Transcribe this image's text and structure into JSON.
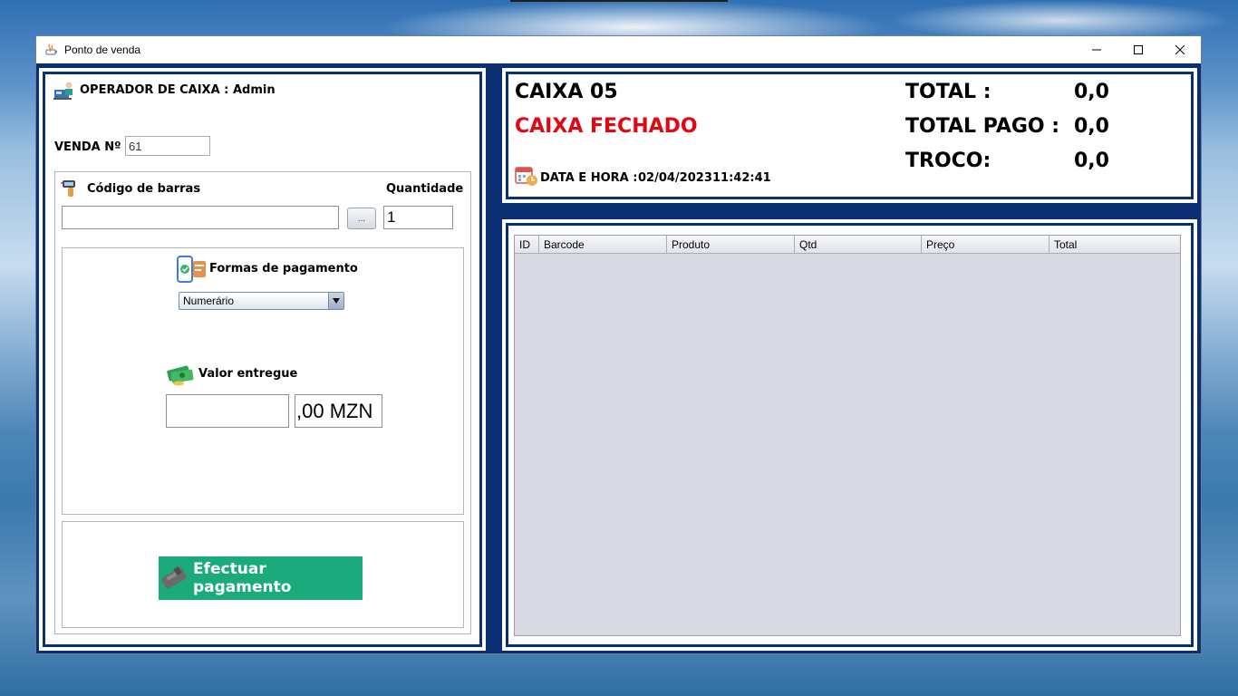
{
  "window": {
    "title": "Ponto de venda"
  },
  "left": {
    "operator_label": "OPERADOR DE CAIXA :",
    "operator_name": "Admin",
    "sale_label": "VENDA Nº",
    "sale_number": "61",
    "barcode_label": "Código de barras",
    "barcode_value": "",
    "browse_button": "...",
    "quantity_label": "Quantidade",
    "quantity_value": "1",
    "payment_methods_label": "Formas de pagamento",
    "payment_method_selected": "Numerário",
    "amount_label": "Valor entregue",
    "amount_value": "",
    "amount_suffix": ",00 MZN",
    "pay_button": "Efectuar pagamento"
  },
  "summary": {
    "register": "CAIXA 05",
    "status": "CAIXA FECHADO",
    "status_color": "#e30613",
    "datetime_label": "DATA E HORA :",
    "date": "02/04/2023",
    "time": "11:42:41",
    "total_label": "TOTAL :",
    "total_value": "0,0",
    "paid_label": "TOTAL PAGO :",
    "paid_value": "0,0",
    "change_label": "TROCO:",
    "change_value": "0,0"
  },
  "table": {
    "columns": [
      "ID",
      "Barcode",
      "Produto",
      "Qtd",
      "Preço",
      "Total"
    ],
    "rows": []
  },
  "icons": [
    "java-app-icon",
    "cashier-icon",
    "barcode-scanner-icon",
    "mobile-payment-icon",
    "money-icon",
    "calendar-clock-icon",
    "card-terminal-icon"
  ],
  "colors": {
    "frame": "#0a2f73",
    "pay_button": "#1aaa7c"
  }
}
